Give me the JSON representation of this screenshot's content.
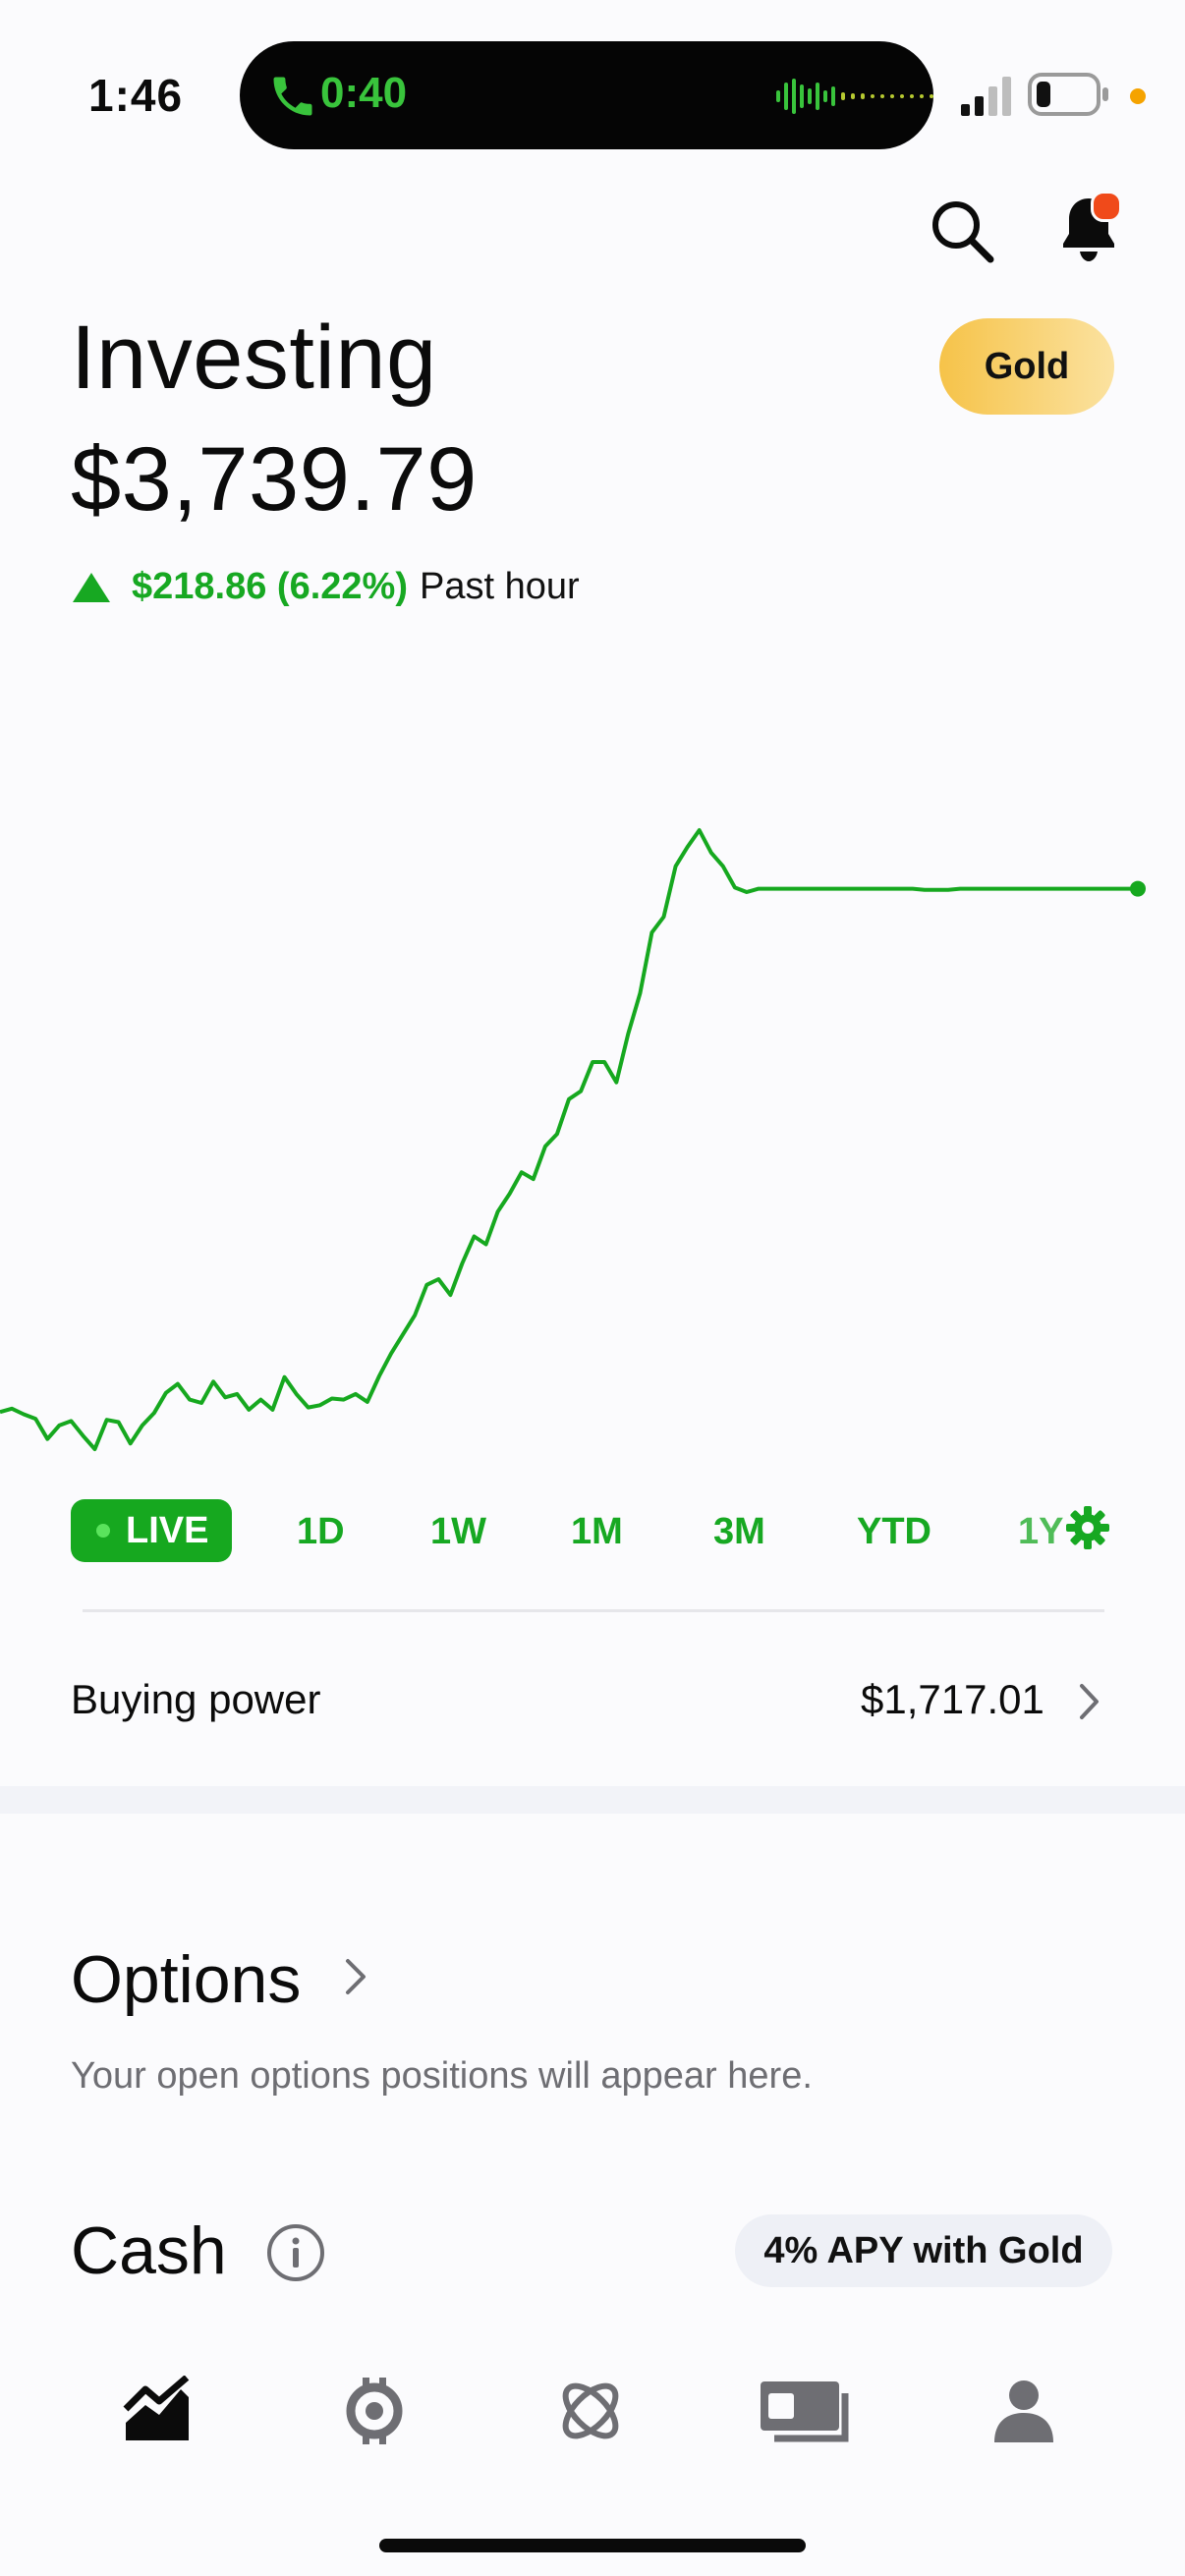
{
  "status_bar": {
    "time": "1:46",
    "call_timer": "0:40",
    "accent_call": "#39c43c"
  },
  "header": {
    "title": "Investing",
    "portfolio_value": "$3,739.79",
    "gold_badge": "Gold",
    "change_amount": "$218.86 (6.22%)",
    "change_period": "Past hour",
    "change_direction": "up",
    "icons": [
      "search-icon",
      "bell-icon"
    ]
  },
  "chart_data": {
    "type": "line",
    "series": [
      {
        "values": [
          100,
          100.3,
          99.8,
          99.4,
          97.6,
          98.8,
          99.2,
          97.9,
          96.7,
          99.3,
          99.1,
          97.2,
          98.8,
          99.9,
          101.7,
          102.5,
          101.1,
          100.8,
          102.7,
          101.3,
          101.6,
          100.2,
          101.1,
          100.2,
          103.1,
          101.6,
          100.4,
          100.6,
          101.2,
          101.1,
          101.6,
          100.9,
          103.2,
          105.2,
          106.9,
          108.6,
          111.3,
          111.8,
          110.4,
          113.2,
          115.6,
          114.9,
          117.8,
          119.4,
          121.3,
          120.7,
          123.6,
          124.7,
          127.8,
          128.5,
          131.1,
          131.1,
          129.3,
          133.6,
          137.2,
          142.6,
          144.0,
          148.5,
          150.2,
          151.7,
          149.7,
          148.5,
          146.6,
          146.2,
          146.5,
          146.5,
          146.5,
          146.5,
          146.5,
          146.5,
          146.5,
          146.5,
          146.5,
          146.5,
          146.5,
          146.5,
          146.5,
          146.5,
          146.4,
          146.4,
          146.4,
          146.5,
          146.5,
          146.5,
          146.5,
          146.5,
          146.5,
          146.5,
          146.5,
          146.5,
          146.5,
          146.5,
          146.5,
          146.5,
          146.5,
          146.5,
          146.5
        ],
        "color": "#16a81f"
      }
    ],
    "grid": false
  },
  "range_selector": {
    "live": "LIVE",
    "items": [
      "1D",
      "1W",
      "1M",
      "3M",
      "YTD",
      "1Y"
    ],
    "settings_icon": "gear-icon"
  },
  "buying_power": {
    "label": "Buying power",
    "value": "$1,717.01"
  },
  "options": {
    "title": "Options",
    "subtitle": "Your open options positions will appear here."
  },
  "cash": {
    "title": "Cash",
    "apy_label": "4% APY with Gold"
  },
  "tabbar": {
    "tabs": [
      "investing-chart-icon",
      "crypto-icon",
      "network-icon",
      "cash-card-icon",
      "account-icon"
    ]
  },
  "colors": {
    "accent_green": "#16a81f",
    "gold": "#f6c349",
    "notification": "#f04a1a"
  }
}
